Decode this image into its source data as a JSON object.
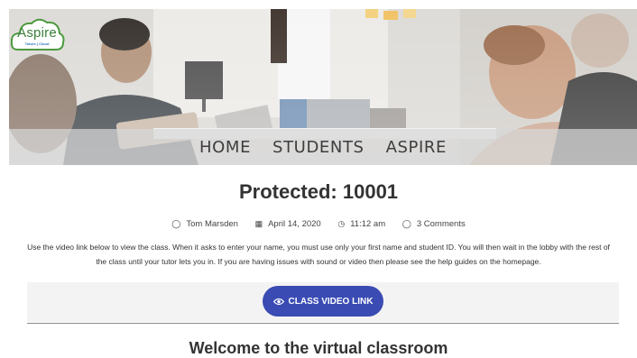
{
  "logo": {
    "text": "Aspire",
    "subtext": "Tutors | Cloud"
  },
  "nav": {
    "items": [
      "HOME",
      "STUDENTS",
      "ASPIRE"
    ]
  },
  "post": {
    "title": "Protected: 10001",
    "meta": {
      "author": "Tom Marsden",
      "date": "April 14, 2020",
      "time": "11:12 am",
      "comments": "3 Comments",
      "icons": [
        "user-icon",
        "calendar-icon",
        "clock-icon",
        "comment-icon"
      ]
    },
    "body": "Use the video link below to view the class. When it asks to enter your name, you must use only your first name and student ID. You will then wait in the lobby with the rest of the class until your tutor lets you in. If you are having issues with sound or video then please see the help guides on the homepage.",
    "video_button": {
      "label": "CLASS VIDEO LINK",
      "icon": "eye-icon"
    },
    "section_heading": "Welcome to the virtual classroom"
  },
  "colors": {
    "accent": "#3a4bb3",
    "logo_green": "#3b7f3a"
  }
}
